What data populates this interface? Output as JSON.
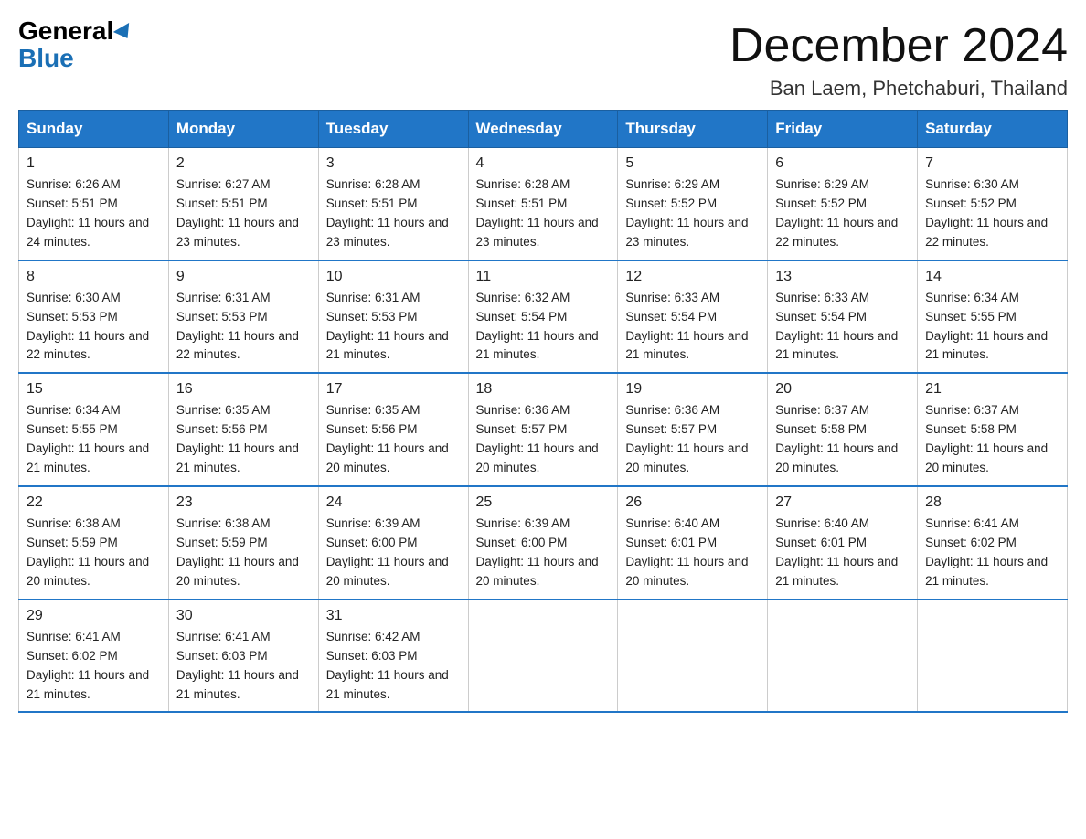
{
  "logo": {
    "part1": "General",
    "part2": "Blue"
  },
  "header": {
    "month_year": "December 2024",
    "location": "Ban Laem, Phetchaburi, Thailand"
  },
  "weekdays": [
    "Sunday",
    "Monday",
    "Tuesday",
    "Wednesday",
    "Thursday",
    "Friday",
    "Saturday"
  ],
  "weeks": [
    [
      {
        "day": "1",
        "sunrise": "6:26 AM",
        "sunset": "5:51 PM",
        "daylight": "11 hours and 24 minutes."
      },
      {
        "day": "2",
        "sunrise": "6:27 AM",
        "sunset": "5:51 PM",
        "daylight": "11 hours and 23 minutes."
      },
      {
        "day": "3",
        "sunrise": "6:28 AM",
        "sunset": "5:51 PM",
        "daylight": "11 hours and 23 minutes."
      },
      {
        "day": "4",
        "sunrise": "6:28 AM",
        "sunset": "5:51 PM",
        "daylight": "11 hours and 23 minutes."
      },
      {
        "day": "5",
        "sunrise": "6:29 AM",
        "sunset": "5:52 PM",
        "daylight": "11 hours and 23 minutes."
      },
      {
        "day": "6",
        "sunrise": "6:29 AM",
        "sunset": "5:52 PM",
        "daylight": "11 hours and 22 minutes."
      },
      {
        "day": "7",
        "sunrise": "6:30 AM",
        "sunset": "5:52 PM",
        "daylight": "11 hours and 22 minutes."
      }
    ],
    [
      {
        "day": "8",
        "sunrise": "6:30 AM",
        "sunset": "5:53 PM",
        "daylight": "11 hours and 22 minutes."
      },
      {
        "day": "9",
        "sunrise": "6:31 AM",
        "sunset": "5:53 PM",
        "daylight": "11 hours and 22 minutes."
      },
      {
        "day": "10",
        "sunrise": "6:31 AM",
        "sunset": "5:53 PM",
        "daylight": "11 hours and 21 minutes."
      },
      {
        "day": "11",
        "sunrise": "6:32 AM",
        "sunset": "5:54 PM",
        "daylight": "11 hours and 21 minutes."
      },
      {
        "day": "12",
        "sunrise": "6:33 AM",
        "sunset": "5:54 PM",
        "daylight": "11 hours and 21 minutes."
      },
      {
        "day": "13",
        "sunrise": "6:33 AM",
        "sunset": "5:54 PM",
        "daylight": "11 hours and 21 minutes."
      },
      {
        "day": "14",
        "sunrise": "6:34 AM",
        "sunset": "5:55 PM",
        "daylight": "11 hours and 21 minutes."
      }
    ],
    [
      {
        "day": "15",
        "sunrise": "6:34 AM",
        "sunset": "5:55 PM",
        "daylight": "11 hours and 21 minutes."
      },
      {
        "day": "16",
        "sunrise": "6:35 AM",
        "sunset": "5:56 PM",
        "daylight": "11 hours and 21 minutes."
      },
      {
        "day": "17",
        "sunrise": "6:35 AM",
        "sunset": "5:56 PM",
        "daylight": "11 hours and 20 minutes."
      },
      {
        "day": "18",
        "sunrise": "6:36 AM",
        "sunset": "5:57 PM",
        "daylight": "11 hours and 20 minutes."
      },
      {
        "day": "19",
        "sunrise": "6:36 AM",
        "sunset": "5:57 PM",
        "daylight": "11 hours and 20 minutes."
      },
      {
        "day": "20",
        "sunrise": "6:37 AM",
        "sunset": "5:58 PM",
        "daylight": "11 hours and 20 minutes."
      },
      {
        "day": "21",
        "sunrise": "6:37 AM",
        "sunset": "5:58 PM",
        "daylight": "11 hours and 20 minutes."
      }
    ],
    [
      {
        "day": "22",
        "sunrise": "6:38 AM",
        "sunset": "5:59 PM",
        "daylight": "11 hours and 20 minutes."
      },
      {
        "day": "23",
        "sunrise": "6:38 AM",
        "sunset": "5:59 PM",
        "daylight": "11 hours and 20 minutes."
      },
      {
        "day": "24",
        "sunrise": "6:39 AM",
        "sunset": "6:00 PM",
        "daylight": "11 hours and 20 minutes."
      },
      {
        "day": "25",
        "sunrise": "6:39 AM",
        "sunset": "6:00 PM",
        "daylight": "11 hours and 20 minutes."
      },
      {
        "day": "26",
        "sunrise": "6:40 AM",
        "sunset": "6:01 PM",
        "daylight": "11 hours and 20 minutes."
      },
      {
        "day": "27",
        "sunrise": "6:40 AM",
        "sunset": "6:01 PM",
        "daylight": "11 hours and 21 minutes."
      },
      {
        "day": "28",
        "sunrise": "6:41 AM",
        "sunset": "6:02 PM",
        "daylight": "11 hours and 21 minutes."
      }
    ],
    [
      {
        "day": "29",
        "sunrise": "6:41 AM",
        "sunset": "6:02 PM",
        "daylight": "11 hours and 21 minutes."
      },
      {
        "day": "30",
        "sunrise": "6:41 AM",
        "sunset": "6:03 PM",
        "daylight": "11 hours and 21 minutes."
      },
      {
        "day": "31",
        "sunrise": "6:42 AM",
        "sunset": "6:03 PM",
        "daylight": "11 hours and 21 minutes."
      },
      null,
      null,
      null,
      null
    ]
  ],
  "labels": {
    "sunrise": "Sunrise: ",
    "sunset": "Sunset: ",
    "daylight": "Daylight: "
  }
}
